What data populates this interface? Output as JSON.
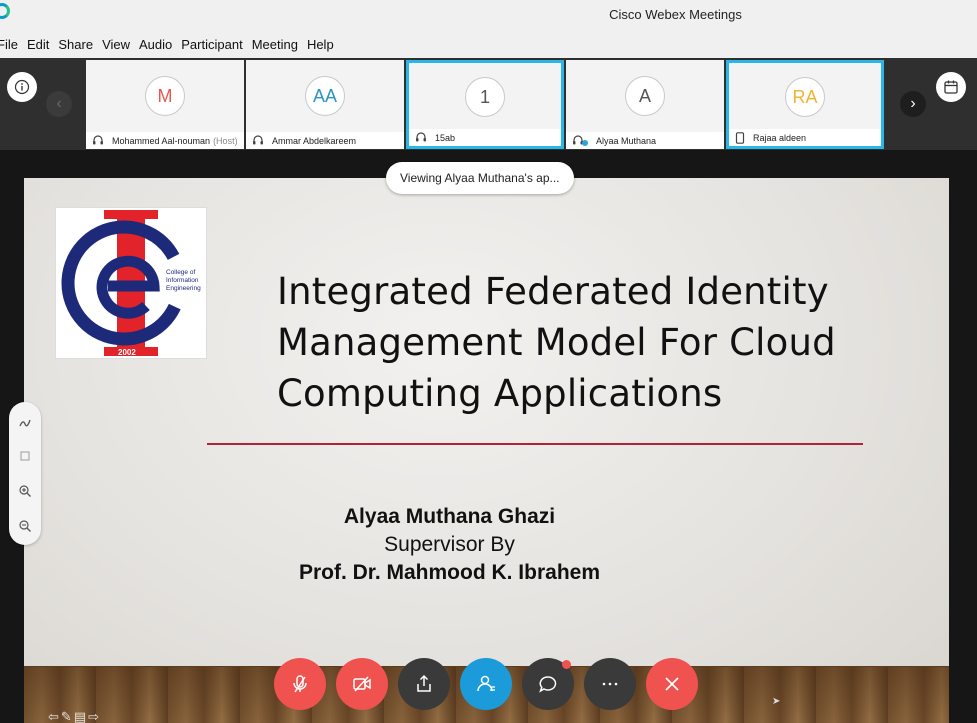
{
  "window": {
    "title": "Cisco Webex Meetings"
  },
  "menu": [
    {
      "label": "File"
    },
    {
      "label": "Edit"
    },
    {
      "label": "Share"
    },
    {
      "label": "View"
    },
    {
      "label": "Audio"
    },
    {
      "label": "Participant"
    },
    {
      "label": "Meeting"
    },
    {
      "label": "Help"
    }
  ],
  "participants": [
    {
      "initials": "M",
      "name": "Mohammed Aal-nouman",
      "tag": "(Host)",
      "color": "#e05a4f",
      "active": false,
      "icon": "headset-icon"
    },
    {
      "initials": "AA",
      "name": "Ammar Abdelkareem",
      "tag": "",
      "color": "#2b93c9",
      "active": false,
      "icon": "headset-icon"
    },
    {
      "initials": "1",
      "name": "15ab",
      "tag": "",
      "color": "#555555",
      "active": true,
      "icon": "headset-icon"
    },
    {
      "initials": "A",
      "name": "Alyaa Muthana",
      "tag": "",
      "color": "#555555",
      "active": false,
      "icon": "headset-share-icon"
    },
    {
      "initials": "RA",
      "name": "Rajaa aldeen",
      "tag": "",
      "color": "#f0b432",
      "active": true,
      "icon": "phone-icon"
    }
  ],
  "viewing_notice": "Viewing Alyaa Muthana's ap...",
  "slide": {
    "logo_text": "College of Information Engineering",
    "logo_year": "2002",
    "title_lines": [
      "Integrated Federated Identity",
      "Management Model For Cloud",
      "Computing Applications"
    ],
    "author": "Alyaa Muthana Ghazi",
    "supervisor_label": "Supervisor By",
    "supervisor": "Prof. Dr. Mahmood K. Ibrahem"
  },
  "colors": {
    "accent": "#29b6e9",
    "danger": "#f0524f",
    "primary": "#1b9bd9",
    "divider": "#b2233a"
  }
}
